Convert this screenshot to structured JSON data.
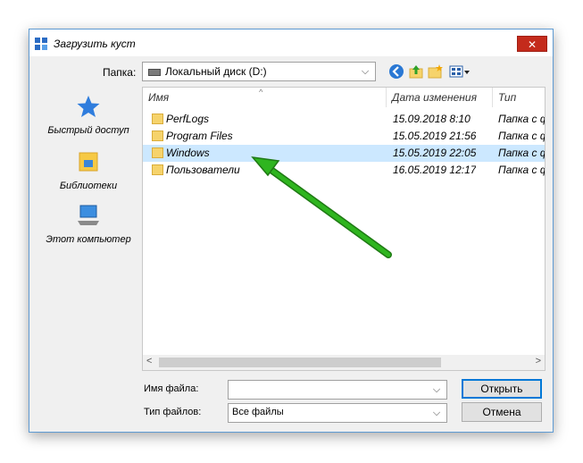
{
  "dialog": {
    "title": "Загрузить куст",
    "close_label": "✕"
  },
  "lookin": {
    "label": "Папка:",
    "value": "Локальный диск (D:)"
  },
  "places": [
    {
      "label": "Быстрый доступ",
      "icon": "star-icon"
    },
    {
      "label": "Библиотеки",
      "icon": "library-icon"
    },
    {
      "label": "Этот компьютер",
      "icon": "computer-icon"
    }
  ],
  "columns": {
    "name": "Имя",
    "date": "Дата изменения",
    "type": "Тип"
  },
  "files": [
    {
      "name": "PerfLogs",
      "date": "15.09.2018 8:10",
      "type": "Папка с ф"
    },
    {
      "name": "Program Files",
      "date": "15.05.2019 21:56",
      "type": "Папка с ф"
    },
    {
      "name": "Windows",
      "date": "15.05.2019 22:05",
      "type": "Папка с ф"
    },
    {
      "name": "Пользователи",
      "date": "16.05.2019 12:17",
      "type": "Папка с ф"
    }
  ],
  "filename": {
    "label": "Имя файла:",
    "value": ""
  },
  "filetype": {
    "label": "Тип файлов:",
    "value": "Все файлы"
  },
  "buttons": {
    "open": "Открыть",
    "cancel": "Отмена"
  },
  "colors": {
    "selection": "#cce8ff",
    "annotation_arrow": "#2fb51f",
    "accent": "#0078d7"
  }
}
